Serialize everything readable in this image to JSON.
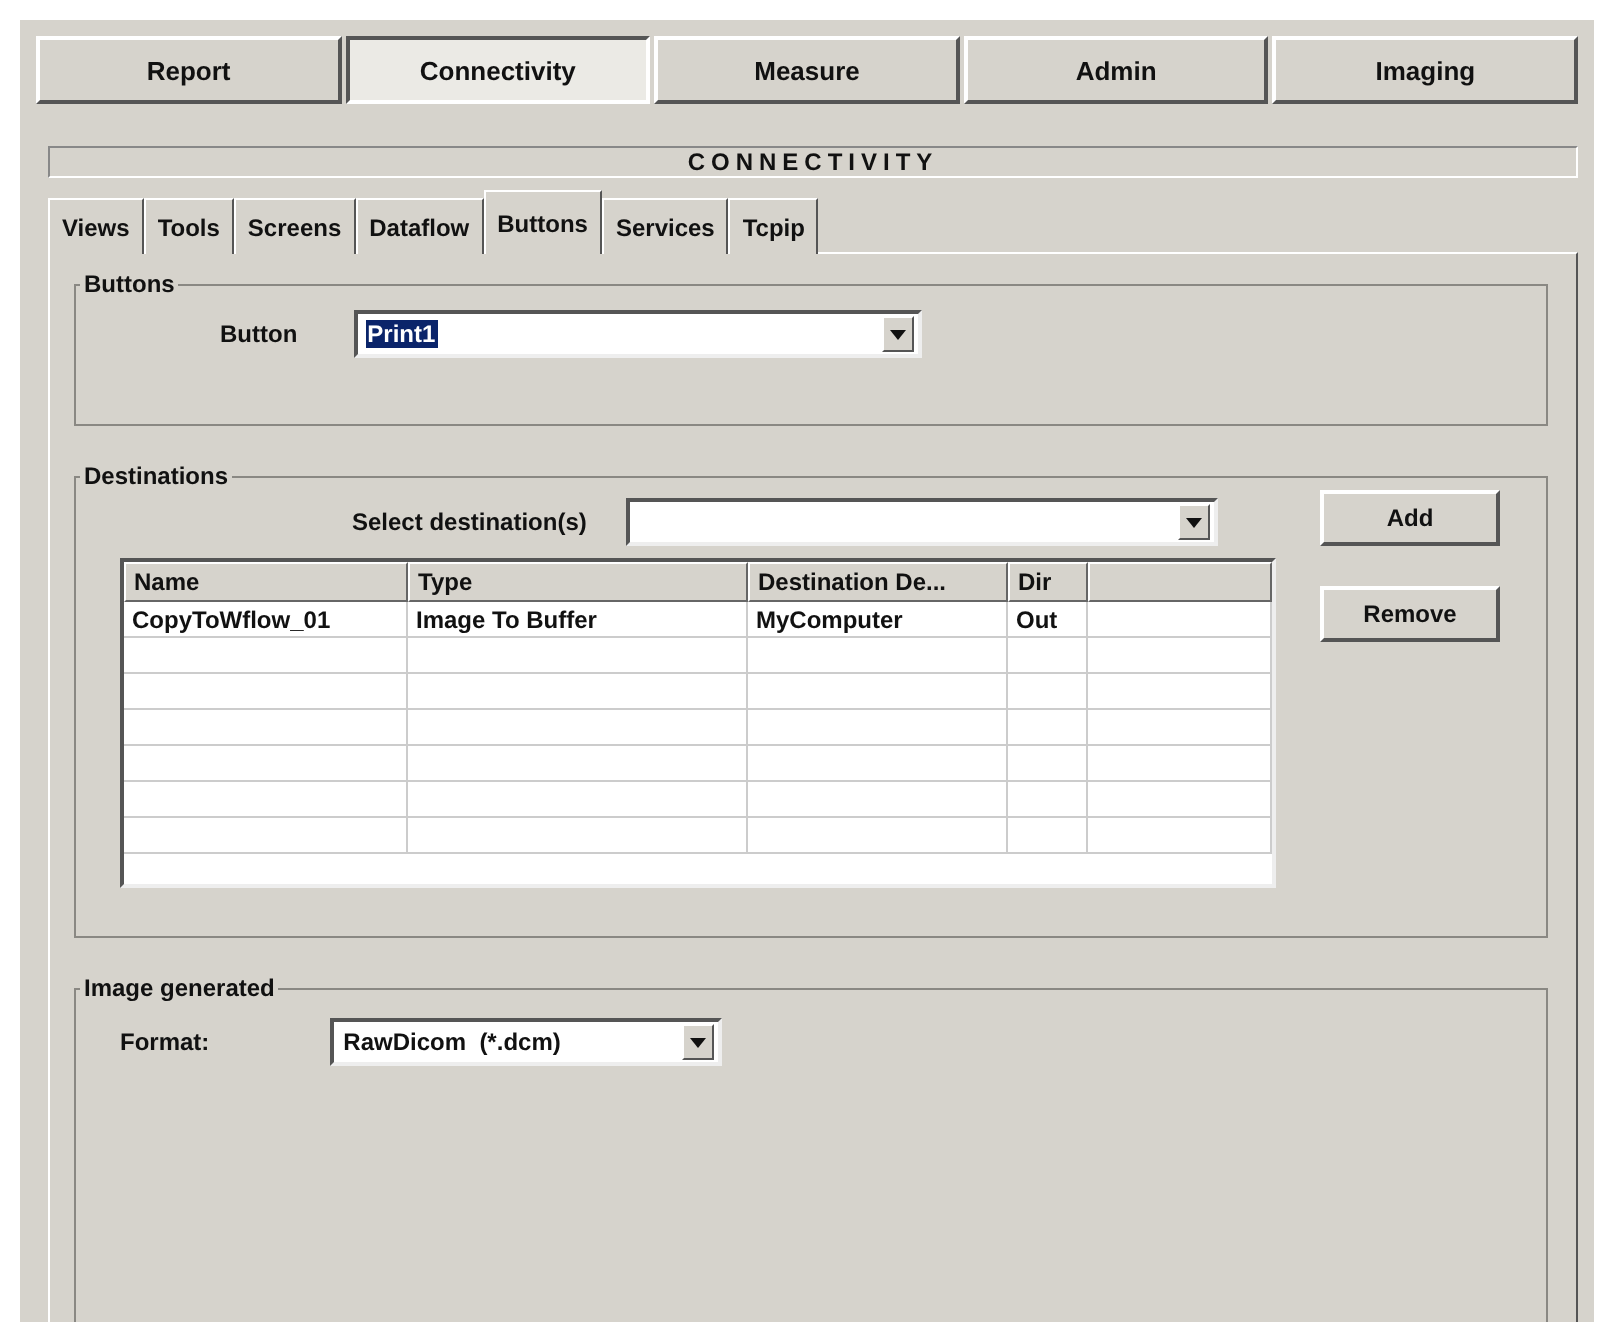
{
  "main_tabs": [
    {
      "label": "Report",
      "selected": false
    },
    {
      "label": "Connectivity",
      "selected": true
    },
    {
      "label": "Measure",
      "selected": false
    },
    {
      "label": "Admin",
      "selected": false
    },
    {
      "label": "Imaging",
      "selected": false
    }
  ],
  "header": "CONNECTIVITY",
  "sub_tabs": [
    {
      "label": "Views",
      "selected": false
    },
    {
      "label": "Tools",
      "selected": false
    },
    {
      "label": "Screens",
      "selected": false
    },
    {
      "label": "Dataflow",
      "selected": false
    },
    {
      "label": "Buttons",
      "selected": true
    },
    {
      "label": "Services",
      "selected": false
    },
    {
      "label": "Tcpip",
      "selected": false
    }
  ],
  "buttons_group": {
    "title": "Buttons",
    "label": "Button",
    "value": "Print1",
    "value_highlighted": true
  },
  "destinations_group": {
    "title": "Destinations",
    "select_label": "Select destination(s)",
    "add_button": "Add",
    "remove_button": "Remove",
    "table": {
      "columns": [
        "Name",
        "Type",
        "Destination De...",
        "Dir"
      ],
      "rows": [
        [
          "CopyToWflow_01",
          "Image To Buffer",
          "MyComputer",
          "Out"
        ]
      ]
    }
  },
  "image_group": {
    "title": "Image generated",
    "format_label": "Format:",
    "format_value": "RawDicom  (*.dcm)"
  }
}
